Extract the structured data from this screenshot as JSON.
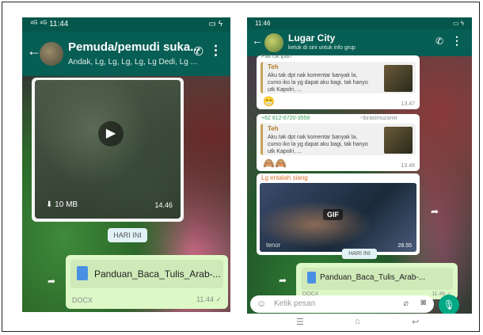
{
  "left_phone": {
    "status_time": "11:44",
    "status_icons": "⁴ᴳ ⁴ᴳ",
    "battery": "▭ ϟ",
    "back": "←",
    "title": "Pemuda/pemudi suka...",
    "subtitle": "Andak, Lg, Lg, Lg, Lg, Lg Dedi, Lg ...",
    "call_icon": "✆",
    "more_icon": "⋮",
    "video": {
      "size": "10 MB",
      "time": "14.46",
      "play": "▶",
      "download_icon": "⬇"
    },
    "day_badge": "HARI INI",
    "doc": {
      "name": "Panduan_Baca_Tulis_Arab-...",
      "type": "DOCX",
      "time": "11.44 ✓"
    }
  },
  "right_phone": {
    "status_time": "11:46",
    "battery": "▭ ϟ",
    "back": "←",
    "title": "Lugar City",
    "subtitle": "ketuk di sini untuk info grup",
    "call_icon": "✆",
    "more_icon": "⋮",
    "messages": [
      {
        "sender": "Pak cik ipan",
        "quote_name": "Teh",
        "quote_text": "Aku tak dpt nak komentar banyak la, cumo iko la yg dapat aku bagi, tak hanyo utk Kapolri, ...",
        "emoji": "😁",
        "time": "13.47"
      },
      {
        "sender": "+62 812-6720-3558",
        "sender_alias": "~Ibrasimuzamir",
        "quote_name": "Teh",
        "quote_text": "Aku tak dpt nak komentar banyak la, cumo iko la yg dapat aku bagi, tak hanyo utk Kapolri, ...",
        "emoji": "🙈🙈",
        "time": "13.48"
      }
    ],
    "gif": {
      "sender": "Lg entalah siang",
      "badge": "GIF",
      "source": "tenor",
      "time": "28.55"
    },
    "day_badge": "HARI INI",
    "doc": {
      "name": "Panduan_Baca_Tulis_Arab-...",
      "type": "DOCX",
      "time": "11.46 ✓"
    },
    "input_placeholder": "Ketik pesan",
    "nav": {
      "menu": "☰",
      "home": "⌂",
      "back": "↩"
    }
  },
  "colors": {
    "header": "#075e54",
    "bubble_out": "#dcf8c6",
    "mic": "#00a884"
  }
}
